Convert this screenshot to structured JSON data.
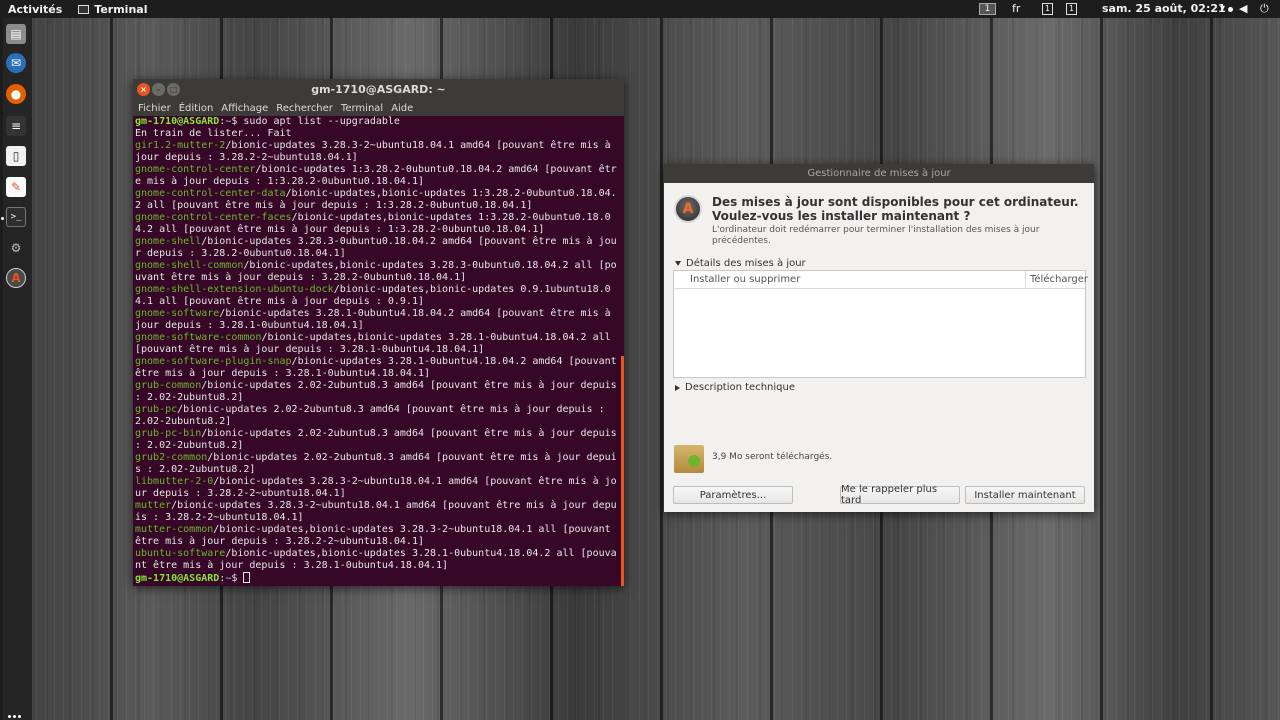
{
  "topbar": {
    "activities": "Activités",
    "app_name": "Terminal",
    "workspace": "1",
    "lang": "fr",
    "box1": "1",
    "box2": "1",
    "datetime": "sam. 25 août, 02:21"
  },
  "dock": {
    "items": [
      "files-icon",
      "thunderbird-icon",
      "firefox-icon",
      "notes-icon",
      "document-icon",
      "text-editor-icon",
      "terminal-icon",
      "settings-icon",
      "software-updater-icon"
    ]
  },
  "terminal": {
    "title": "gm-1710@ASGARD: ~",
    "menu": [
      "Fichier",
      "Édition",
      "Affichage",
      "Rechercher",
      "Terminal",
      "Aide"
    ],
    "prompt_user": "gm-1710@ASGARD",
    "prompt_path": "~",
    "command": "sudo apt list --upgradable",
    "listing": "En train de lister... Fait",
    "packages": [
      {
        "name": "gir1.2-mutter-2",
        "rest": "/bionic-updates 3.28.3-2~ubuntu18.04.1 amd64 [pouvant être mis à jour depuis : 3.28.2-2~ubuntu18.04.1]"
      },
      {
        "name": "gnome-control-center",
        "rest": "/bionic-updates 1:3.28.2-0ubuntu0.18.04.2 amd64 [pouvant être mis à jour depuis : 1:3.28.2-0ubuntu0.18.04.1]"
      },
      {
        "name": "gnome-control-center-data",
        "rest": "/bionic-updates,bionic-updates 1:3.28.2-0ubuntu0.18.04.2 all [pouvant être mis à jour depuis : 1:3.28.2-0ubuntu0.18.04.1]"
      },
      {
        "name": "gnome-control-center-faces",
        "rest": "/bionic-updates,bionic-updates 1:3.28.2-0ubuntu0.18.04.2 all [pouvant être mis à jour depuis : 1:3.28.2-0ubuntu0.18.04.1]"
      },
      {
        "name": "gnome-shell",
        "rest": "/bionic-updates 3.28.3-0ubuntu0.18.04.2 amd64 [pouvant être mis à jour depuis : 3.28.2-0ubuntu0.18.04.1]"
      },
      {
        "name": "gnome-shell-common",
        "rest": "/bionic-updates,bionic-updates 3.28.3-0ubuntu0.18.04.2 all [pouvant être mis à jour depuis : 3.28.2-0ubuntu0.18.04.1]"
      },
      {
        "name": "gnome-shell-extension-ubuntu-dock",
        "rest": "/bionic-updates,bionic-updates 0.9.1ubuntu18.04.1 all [pouvant être mis à jour depuis : 0.9.1]"
      },
      {
        "name": "gnome-software",
        "rest": "/bionic-updates 3.28.1-0ubuntu4.18.04.2 amd64 [pouvant être mis à jour depuis : 3.28.1-0ubuntu4.18.04.1]"
      },
      {
        "name": "gnome-software-common",
        "rest": "/bionic-updates,bionic-updates 3.28.1-0ubuntu4.18.04.2 all [pouvant être mis à jour depuis : 3.28.1-0ubuntu4.18.04.1]"
      },
      {
        "name": "gnome-software-plugin-snap",
        "rest": "/bionic-updates 3.28.1-0ubuntu4.18.04.2 amd64 [pouvant être mis à jour depuis : 3.28.1-0ubuntu4.18.04.1]"
      },
      {
        "name": "grub-common",
        "rest": "/bionic-updates 2.02-2ubuntu8.3 amd64 [pouvant être mis à jour depuis : 2.02-2ubuntu8.2]"
      },
      {
        "name": "grub-pc",
        "rest": "/bionic-updates 2.02-2ubuntu8.3 amd64 [pouvant être mis à jour depuis : 2.02-2ubuntu8.2]"
      },
      {
        "name": "grub-pc-bin",
        "rest": "/bionic-updates 2.02-2ubuntu8.3 amd64 [pouvant être mis à jour depuis : 2.02-2ubuntu8.2]"
      },
      {
        "name": "grub2-common",
        "rest": "/bionic-updates 2.02-2ubuntu8.3 amd64 [pouvant être mis à jour depuis : 2.02-2ubuntu8.2]"
      },
      {
        "name": "libmutter-2-0",
        "rest": "/bionic-updates 3.28.3-2~ubuntu18.04.1 amd64 [pouvant être mis à jour depuis : 3.28.2-2~ubuntu18.04.1]"
      },
      {
        "name": "mutter",
        "rest": "/bionic-updates 3.28.3-2~ubuntu18.04.1 amd64 [pouvant être mis à jour depuis : 3.28.2-2~ubuntu18.04.1]"
      },
      {
        "name": "mutter-common",
        "rest": "/bionic-updates,bionic-updates 3.28.3-2~ubuntu18.04.1 all [pouvant être mis à jour depuis : 3.28.2-2~ubuntu18.04.1]"
      },
      {
        "name": "ubuntu-software",
        "rest": "/bionic-updates,bionic-updates 3.28.1-0ubuntu4.18.04.2 all [pouvant être mis à jour depuis : 3.28.1-0ubuntu4.18.04.1]"
      }
    ]
  },
  "updater": {
    "title": "Gestionnaire de mises à jour",
    "heading": "Des mises à jour sont disponibles pour cet ordinateur. Voulez-vous les installer maintenant ?",
    "subtext": "L'ordinateur doit redémarrer pour terminer l'installation des mises à jour précédentes.",
    "details_label": "Détails des mises à jour",
    "col_install": "Installer ou supprimer",
    "col_download": "Télécharger",
    "tech_label": "Description technique",
    "download_size": "3,9 Mo seront téléchargés.",
    "btn_settings": "Paramètres...",
    "btn_remind": "Me le rappeler plus tard",
    "btn_install": "Installer maintenant"
  }
}
